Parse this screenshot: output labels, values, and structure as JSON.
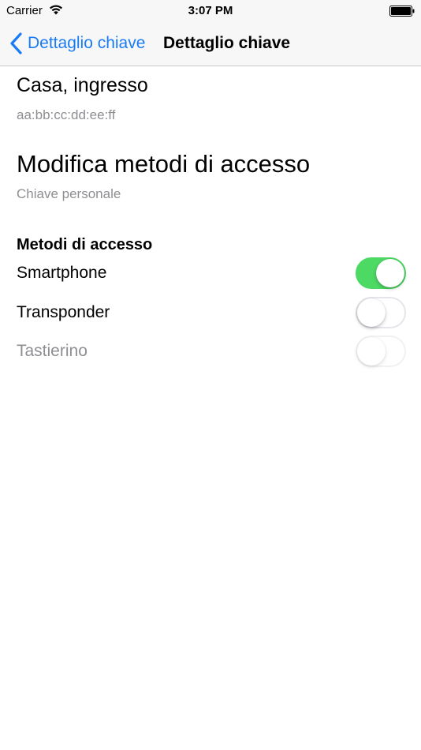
{
  "status_bar": {
    "carrier": "Carrier",
    "time": "3:07 PM",
    "wifi_icon": "wifi-icon",
    "battery_icon": "battery-icon"
  },
  "nav": {
    "back_label": "Dettaglio chiave",
    "back_icon": "chevron-left-icon",
    "title": "Dettaglio chiave"
  },
  "key": {
    "name": "Casa, ingresso",
    "address": "aa:bb:cc:dd:ee:ff"
  },
  "edit": {
    "title": "Modifica metodi di accesso",
    "key_type": "Chiave personale"
  },
  "methods": {
    "header": "Metodi di accesso",
    "items": [
      {
        "label": "Smartphone",
        "enabled": true,
        "available": true
      },
      {
        "label": "Transponder",
        "enabled": false,
        "available": true
      },
      {
        "label": "Tastierino",
        "enabled": false,
        "available": false
      }
    ]
  },
  "colors": {
    "accent": "#1a7cf5",
    "switch_on": "#4cd964",
    "secondary_text": "#8e8e93",
    "bar_background": "#f7f7f7"
  }
}
